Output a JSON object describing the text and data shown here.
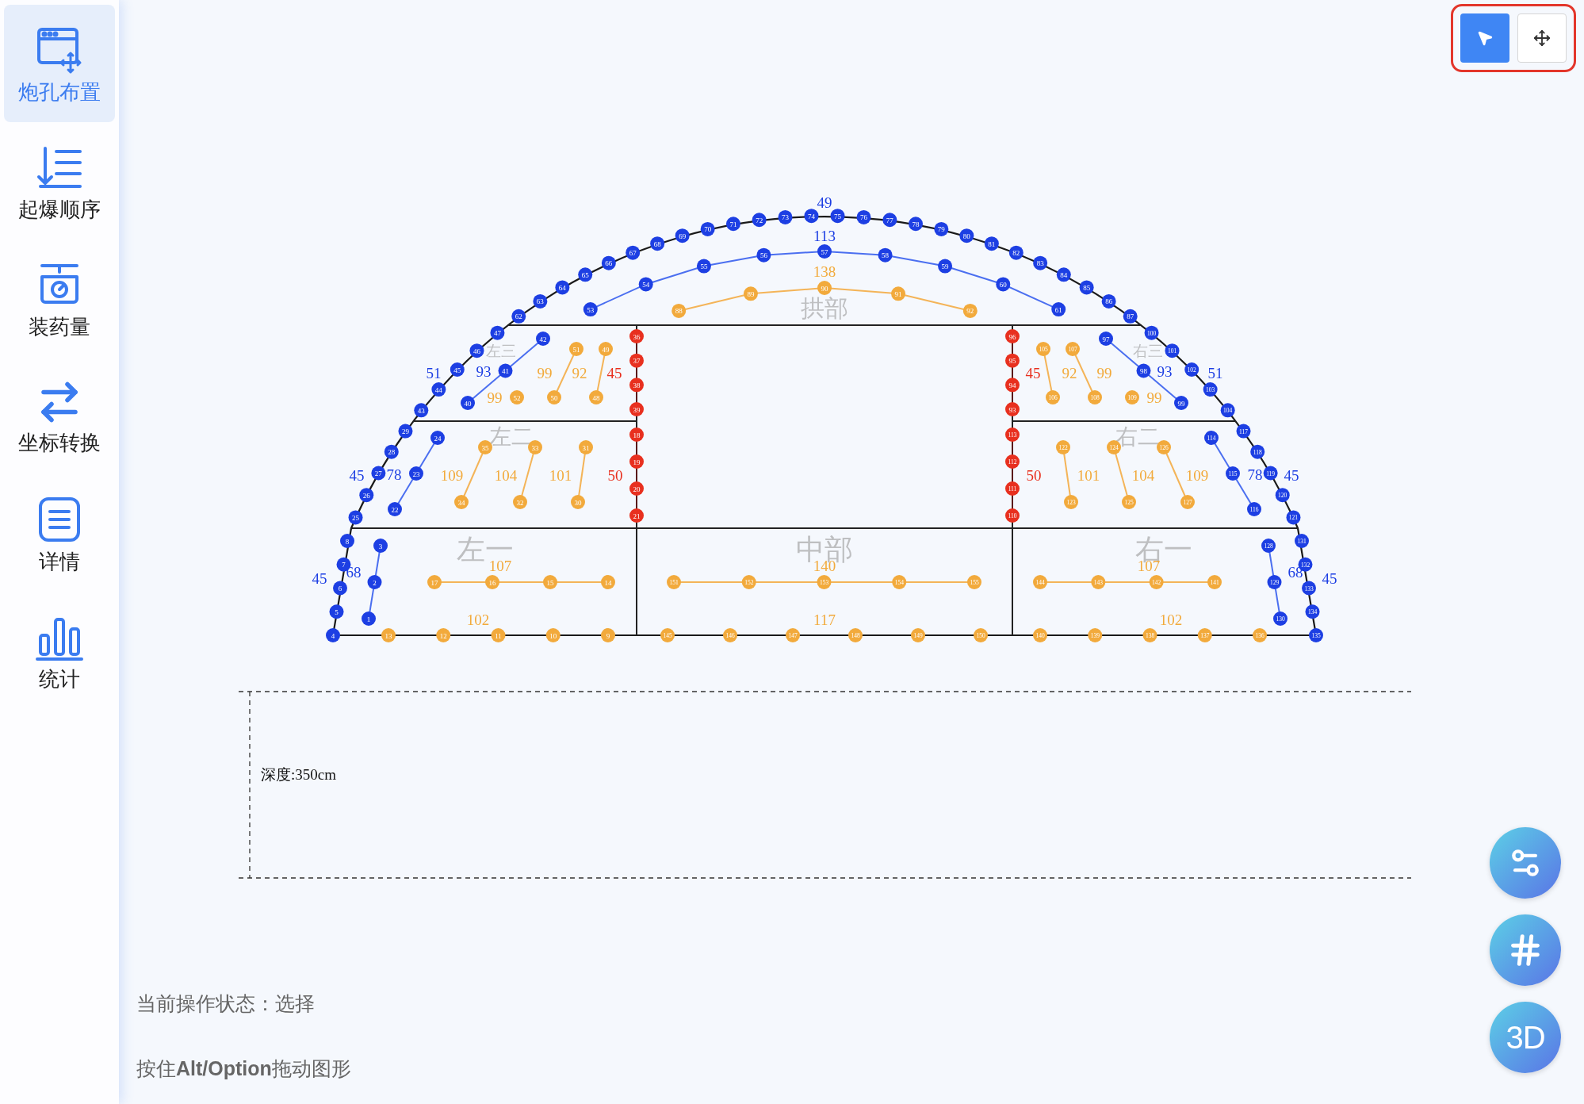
{
  "sidebar": {
    "items": [
      {
        "label": "炮孔布置",
        "selected": true
      },
      {
        "label": "起爆顺序",
        "selected": false
      },
      {
        "label": "装药量",
        "selected": false
      },
      {
        "label": "坐标转换",
        "selected": false
      },
      {
        "label": "详情",
        "selected": false
      },
      {
        "label": "统计",
        "selected": false
      }
    ]
  },
  "toolbar": {
    "tools": [
      {
        "kind": "select",
        "selected": true
      },
      {
        "kind": "move",
        "selected": false
      }
    ]
  },
  "diagram": {
    "sections": [
      {
        "name": "拱部"
      },
      {
        "name": "左三"
      },
      {
        "name": "右三"
      },
      {
        "name": "左二"
      },
      {
        "name": "右二"
      },
      {
        "name": "左一"
      },
      {
        "name": "中部"
      },
      {
        "name": "右一"
      }
    ],
    "groups": [
      {
        "kind": "perimeter",
        "label": "49",
        "holes": [
          "62",
          "63",
          "64",
          "65",
          "66",
          "67",
          "68",
          "69",
          "70",
          "71",
          "72",
          "73",
          "74",
          "75",
          "76",
          "77",
          "78",
          "79",
          "80",
          "81",
          "82",
          "83",
          "84",
          "85",
          "86",
          "87"
        ]
      },
      {
        "kind": "contour",
        "label": "113",
        "holes": [
          "53",
          "54",
          "55",
          "56",
          "57",
          "58",
          "59",
          "60",
          "61"
        ]
      },
      {
        "kind": "easer",
        "label": "138",
        "holes": [
          "88",
          "89",
          "90",
          "91",
          "92"
        ]
      },
      {
        "kind": "perimeter",
        "label": "51",
        "holes": [
          "43",
          "44",
          "45",
          "46",
          "47"
        ]
      },
      {
        "kind": "contour",
        "label": "93",
        "holes": [
          "40",
          "41",
          "42"
        ]
      },
      {
        "kind": "easer",
        "label": "99",
        "holes": [
          "52"
        ]
      },
      {
        "kind": "easer",
        "label": "99",
        "holes": [
          "50",
          "51"
        ]
      },
      {
        "kind": "easer",
        "label": "92",
        "holes": [
          "48",
          "49"
        ]
      },
      {
        "kind": "cut",
        "label": "45",
        "holes": [
          "36",
          "37",
          "38",
          "39"
        ]
      },
      {
        "kind": "cut",
        "label": "45",
        "holes": [
          "96",
          "95",
          "94",
          "93"
        ]
      },
      {
        "kind": "easer",
        "label": "92",
        "holes": [
          "105",
          "106"
        ]
      },
      {
        "kind": "easer",
        "label": "99",
        "holes": [
          "107",
          "108"
        ]
      },
      {
        "kind": "easer",
        "label": "99",
        "holes": [
          "109"
        ]
      },
      {
        "kind": "contour",
        "label": "93",
        "holes": [
          "97",
          "98",
          "99"
        ]
      },
      {
        "kind": "perimeter",
        "label": "51",
        "holes": [
          "100",
          "101",
          "102",
          "103",
          "104"
        ]
      },
      {
        "kind": "perimeter",
        "label": "45",
        "holes": [
          "25",
          "26",
          "27",
          "28",
          "29"
        ]
      },
      {
        "kind": "contour",
        "label": "78",
        "holes": [
          "22",
          "23",
          "24"
        ]
      },
      {
        "kind": "easer",
        "label": "109",
        "holes": [
          "34",
          "35"
        ]
      },
      {
        "kind": "easer",
        "label": "104",
        "holes": [
          "32",
          "33"
        ]
      },
      {
        "kind": "easer",
        "label": "101",
        "holes": [
          "30",
          "31"
        ]
      },
      {
        "kind": "cut",
        "label": "50",
        "holes": [
          "18",
          "19",
          "20",
          "21"
        ]
      },
      {
        "kind": "cut",
        "label": "50",
        "holes": [
          "113",
          "112",
          "111",
          "110"
        ]
      },
      {
        "kind": "easer",
        "label": "101",
        "holes": [
          "122",
          "123"
        ]
      },
      {
        "kind": "easer",
        "label": "104",
        "holes": [
          "124",
          "125"
        ]
      },
      {
        "kind": "easer",
        "label": "109",
        "holes": [
          "126",
          "127"
        ]
      },
      {
        "kind": "contour",
        "label": "78",
        "holes": [
          "114",
          "115",
          "116"
        ]
      },
      {
        "kind": "perimeter",
        "label": "45",
        "holes": [
          "117",
          "118",
          "119",
          "120",
          "121"
        ]
      },
      {
        "kind": "perimeter",
        "label": "45",
        "holes": [
          "8",
          "7",
          "6",
          "5",
          "4"
        ]
      },
      {
        "kind": "contour",
        "label": "68",
        "holes": [
          "3",
          "2",
          "1"
        ]
      },
      {
        "kind": "easer",
        "label": "107",
        "holes": [
          "17",
          "16",
          "15",
          "14"
        ]
      },
      {
        "kind": "easer",
        "label": "140",
        "holes": [
          "151",
          "152",
          "153",
          "154",
          "155"
        ]
      },
      {
        "kind": "easer",
        "label": "107",
        "holes": [
          "144",
          "143",
          "142",
          "141"
        ]
      },
      {
        "kind": "contour",
        "label": "68",
        "holes": [
          "128",
          "129",
          "130"
        ]
      },
      {
        "kind": "floor",
        "label": "102",
        "holes": [
          "13",
          "12",
          "11",
          "10",
          "9"
        ]
      },
      {
        "kind": "floor",
        "label": "117",
        "holes": [
          "145",
          "146",
          "147",
          "148",
          "149",
          "150"
        ]
      },
      {
        "kind": "floor",
        "label": "102",
        "holes": [
          "140",
          "139",
          "138",
          "137",
          "136"
        ]
      },
      {
        "kind": "perimeter",
        "label": "45",
        "holes": [
          "131",
          "132",
          "133",
          "134",
          "135"
        ]
      }
    ],
    "depth": "深度:350cm"
  },
  "status": {
    "operation": "当前操作状态：选择",
    "hint": "按住**Alt/Option**拖动图形"
  },
  "float_buttons": [
    {
      "kind": "settings"
    },
    {
      "kind": "grid"
    },
    {
      "kind": "view3d",
      "label": "3D"
    }
  ]
}
